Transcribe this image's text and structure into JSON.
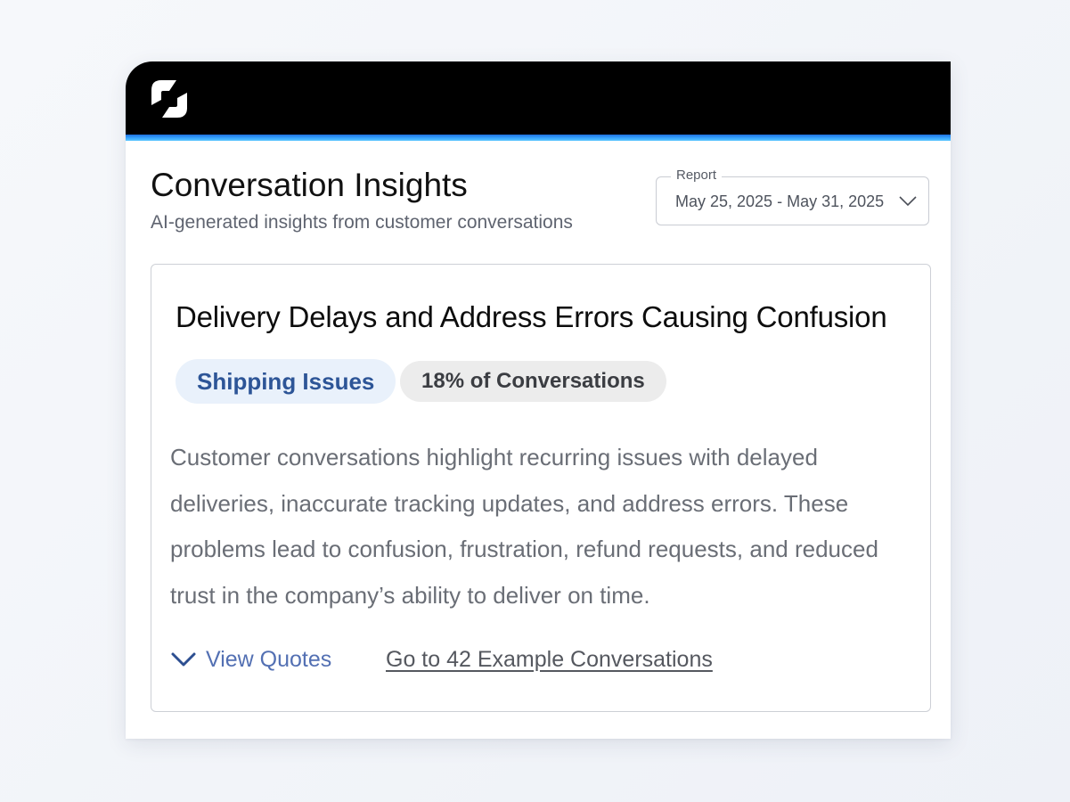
{
  "header": {
    "logo_icon": "company-logo-icon"
  },
  "colors": {
    "topbar": "#000000",
    "accent": "#3aa9ff",
    "tag_primary_bg": "#e9f1fb",
    "tag_primary_text": "#2d5597",
    "tag_secondary_bg": "#ececec",
    "link": "#5370b3"
  },
  "page": {
    "title": "Conversation Insights",
    "subtitle": "AI-generated insights from customer conversations"
  },
  "report": {
    "label": "Report",
    "selected": "May 25, 2025 - May 31, 2025",
    "icon": "chevron-down-icon"
  },
  "insight": {
    "title": "Delivery Delays and Address Errors Causing Confusion",
    "category": "Shipping Issues",
    "share": "18% of Conversations",
    "summary": "Customer conversations highlight recurring issues with delayed deliveries, inaccurate tracking updates, and address errors. These problems lead to confusion, frustration, refund requests, and reduced trust in the company’s ability to deliver on time.",
    "view_quotes_label": "View Quotes",
    "view_quotes_icon": "chevron-down-icon",
    "examples_link": "Go to 42 Example Conversations"
  }
}
